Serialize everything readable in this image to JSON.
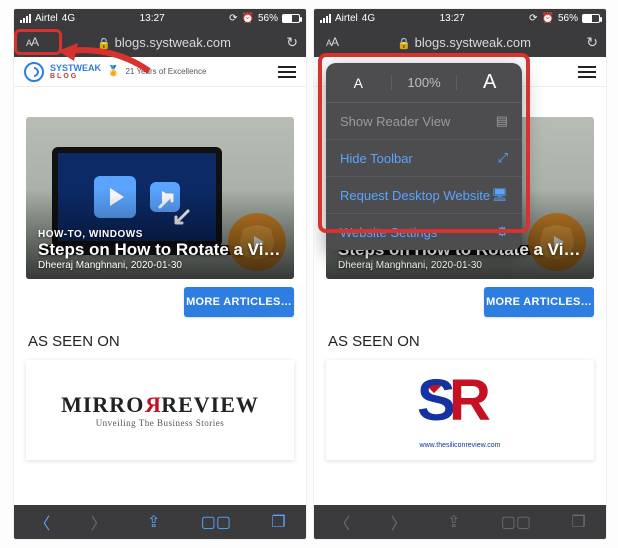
{
  "status": {
    "carrier": "Airtel",
    "network": "4G",
    "time": "13:27",
    "battery_pct": "56%"
  },
  "urlbar": {
    "aa_label": "AA",
    "url": "blogs.systweak.com"
  },
  "header": {
    "brand_top": "SYSTWEAK",
    "brand_bottom": "BLOG",
    "tagline": "21 Years of Excellence"
  },
  "popup": {
    "zoom": "100%",
    "show_reader": "Show Reader View",
    "hide_toolbar": "Hide Toolbar",
    "request_desktop": "Request Desktop Website",
    "website_settings": "Website Settings"
  },
  "article": {
    "categories": "HOW-TO, WINDOWS",
    "title": "Steps on How to Rotate a Vide…",
    "author": "Dheeraj Manghnani",
    "date": "2020-01-30"
  },
  "more_articles": "MORE ARTICLES…",
  "as_seen_on": "AS SEEN ON",
  "press_left": {
    "line1": "MIRRORREVIEW",
    "line1_html_prefix": "MIRRO",
    "line1_html_mid": "R",
    "line1_html_suffix": "REVIEW",
    "sub": "Unveiling The Business Stories"
  },
  "press_right": {
    "tag": "www.thesiliconreview.com"
  }
}
